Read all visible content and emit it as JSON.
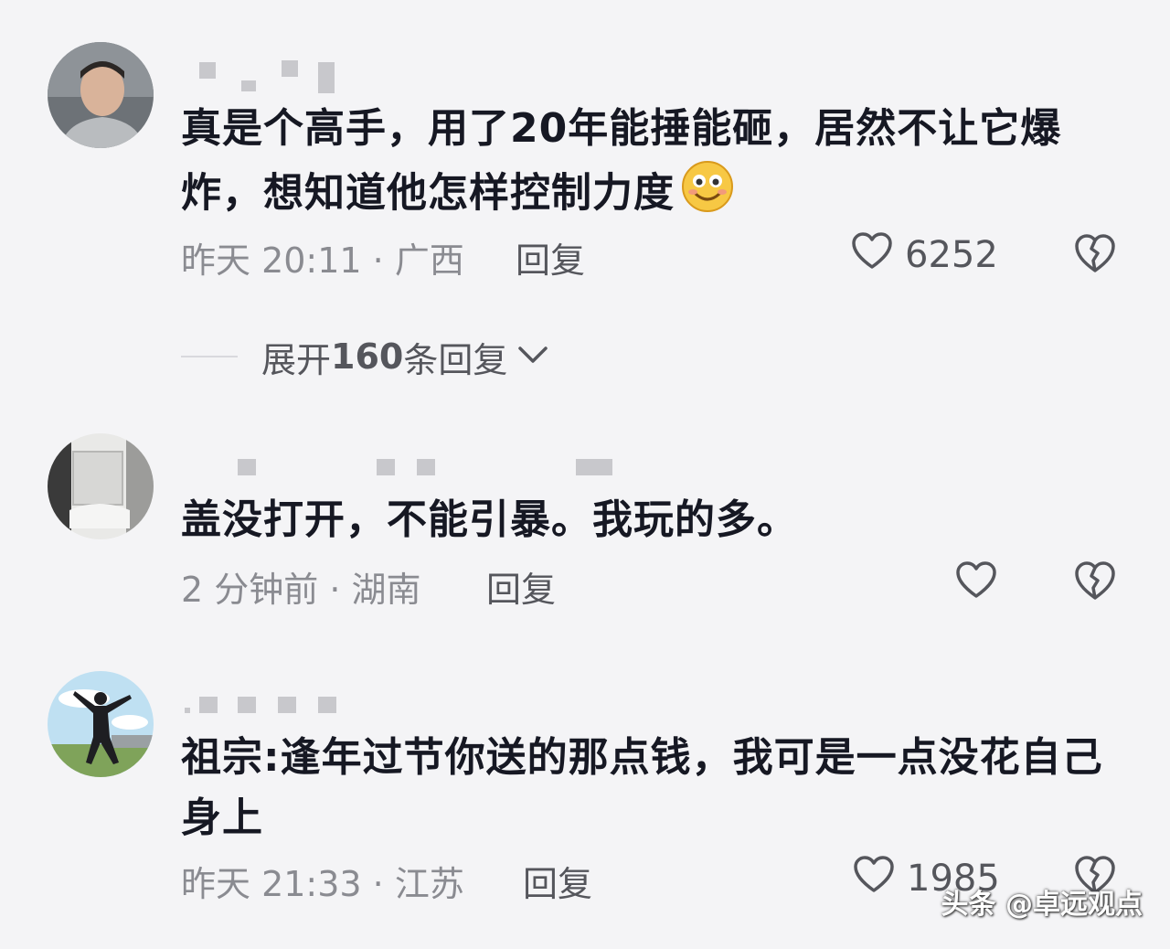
{
  "comments": [
    {
      "text": "真是个高手，用了20年能捶能砸，居然不让它爆炸，想知道他怎样控制力度",
      "meta": "昨天 20:11 · 广西",
      "reply_label": "回复",
      "like_count": "6252"
    },
    {
      "text": "盖没打开，不能引暴。我玩的多。",
      "meta": "2 分钟前 · 湖南",
      "reply_label": "回复",
      "like_count": ""
    },
    {
      "text": "祖宗:逢年过节你送的那点钱，我可是一点没花自己身上",
      "meta": "昨天 21:33 · 江苏",
      "reply_label": "回复",
      "like_count": "1985"
    }
  ],
  "expand": {
    "prefix": "展开 ",
    "count": "160",
    "suffix": " 条回复"
  },
  "watermark": "头条 @卓远观点",
  "icons": {
    "like": "heart-outline-icon",
    "dislike": "broken-heart-icon",
    "expand": "chevron-down-icon",
    "emoji": "smile-emoji-icon"
  },
  "colors": {
    "background": "#f4f4f6",
    "text": "#161823",
    "meta": "#8a8b91",
    "action": "#55565c"
  }
}
